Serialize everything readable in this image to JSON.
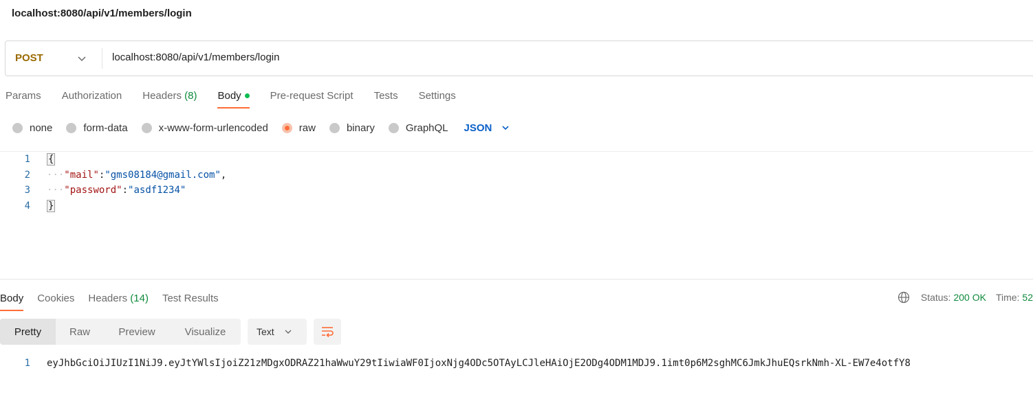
{
  "request": {
    "title": "localhost:8080/api/v1/members/login",
    "method": "POST",
    "url": "localhost:8080/api/v1/members/login"
  },
  "request_tabs": [
    {
      "label": "Params"
    },
    {
      "label": "Authorization"
    },
    {
      "label": "Headers",
      "count": "(8)"
    },
    {
      "label": "Body"
    },
    {
      "label": "Pre-request Script"
    },
    {
      "label": "Tests"
    },
    {
      "label": "Settings"
    }
  ],
  "body_types": {
    "options": [
      "none",
      "form-data",
      "x-www-form-urlencoded",
      "raw",
      "binary",
      "GraphQL"
    ],
    "selected": "raw",
    "format": "JSON"
  },
  "request_body": {
    "line_numbers": [
      "1",
      "2",
      "3",
      "4"
    ],
    "open_brace": "{",
    "close_brace": "}",
    "indent": "···",
    "mail_key": "\"mail\"",
    "mail_value": "\"gms08184@gmail.com\"",
    "password_key": "\"password\"",
    "password_value": "\"asdf1234\"",
    "colon": ":",
    "comma": ","
  },
  "response_tabs": [
    {
      "label": "Body"
    },
    {
      "label": "Cookies"
    },
    {
      "label": "Headers",
      "count": "(14)"
    },
    {
      "label": "Test Results"
    }
  ],
  "status": {
    "label": "Status:",
    "value": "200 OK",
    "time_label": "Time:",
    "time_value": "52"
  },
  "response_view": {
    "modes": [
      "Pretty",
      "Raw",
      "Preview",
      "Visualize"
    ],
    "selected": "Pretty",
    "language": "Text"
  },
  "response_body": {
    "line_number": "1",
    "content": "eyJhbGciOiJIUzI1NiJ9.eyJtYWlsIjoiZ21zMDgxODRAZ21haWwuY29tIiwiaWF0IjoxNjg4ODc5OTAyLCJleHAiOjE2ODg4ODM1MDJ9.1imt0p6M2sghMC6JmkJhuEQsrkNmh-XL-EW7e4otfY8"
  },
  "colors": {
    "accent": "#ff6c37",
    "method": "#9a6a00",
    "success": "#0e8a3c",
    "link": "#0b61c8"
  }
}
